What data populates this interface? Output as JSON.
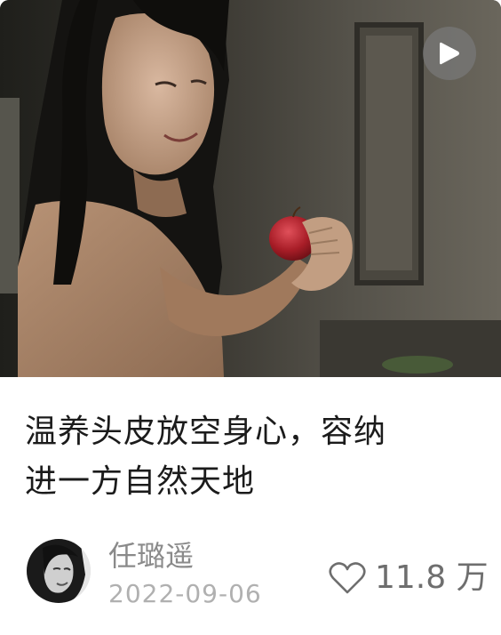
{
  "post": {
    "title_line1": "温养头皮放空身心，容纳",
    "title_line2": "进一方自然天地",
    "author": "任璐遥",
    "date": "2022-09-06",
    "likes": "11.8 万"
  },
  "icons": {
    "play": "play-icon",
    "like": "heart-outline-icon",
    "media": "video-cover-image",
    "avatar": "author-avatar"
  },
  "colors": {
    "title": "#1b1b1b",
    "author": "#8a8a8a",
    "date": "#b0b0b0",
    "likes": "#6e6e6e",
    "play_button_bg": "#787878"
  }
}
